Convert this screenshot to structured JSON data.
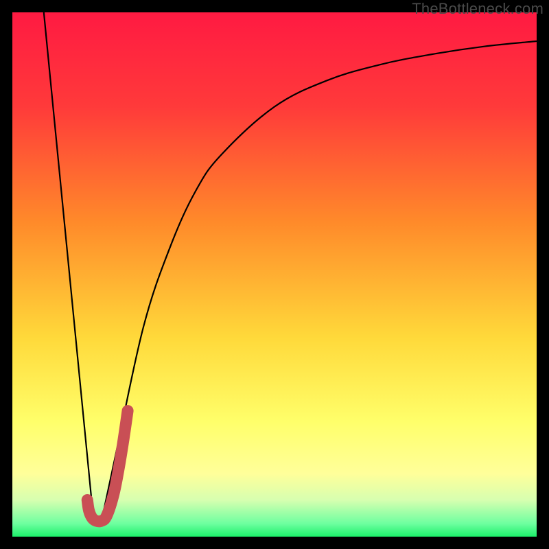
{
  "attribution": "TheBottleneck.com",
  "colors": {
    "bg_black": "#000000",
    "grad_top_red": "#ff1a42",
    "grad_orange": "#ff8a2a",
    "grad_yellow": "#ffe83a",
    "grad_pale_yellow": "#ffff9a",
    "grad_pale_green": "#c7ffa0",
    "grad_green": "#1cf06a",
    "curve_black": "#000000",
    "j_red": "#c94f55"
  },
  "chart_data": {
    "type": "line",
    "title": "",
    "xlabel": "",
    "ylabel": "",
    "xlim": [
      0,
      100
    ],
    "ylim": [
      0,
      100
    ],
    "grid": false,
    "legend": false,
    "series": [
      {
        "name": "left-line",
        "description": "Straight descending line from top-left toward bottom-left minimum",
        "x": [
          6,
          15.5
        ],
        "values": [
          100,
          3
        ]
      },
      {
        "name": "right-curve",
        "description": "Logarithmic-style ascending curve from minimum toward upper-right",
        "x": [
          17,
          20,
          25,
          30,
          35,
          40,
          50,
          60,
          70,
          80,
          90,
          100
        ],
        "values": [
          3,
          17,
          40,
          55,
          66,
          73,
          82,
          87,
          90,
          92,
          93.5,
          94.5
        ]
      },
      {
        "name": "j-mark",
        "description": "Thick red J-shaped mark at the curve minimum",
        "x": [
          14.3,
          14.6,
          15.2,
          16.0,
          17.0,
          18.0,
          19.3,
          20.3,
          21.2,
          22.0
        ],
        "values": [
          7.0,
          5.0,
          3.6,
          3.0,
          3.0,
          4.0,
          8.0,
          13.0,
          18.5,
          24.0
        ]
      }
    ],
    "gradient_stops": [
      {
        "pos": 0.0,
        "color": "#ff1a42"
      },
      {
        "pos": 0.18,
        "color": "#ff3a3a"
      },
      {
        "pos": 0.4,
        "color": "#ff8a2a"
      },
      {
        "pos": 0.62,
        "color": "#ffd93a"
      },
      {
        "pos": 0.78,
        "color": "#ffff6a"
      },
      {
        "pos": 0.88,
        "color": "#ffff9a"
      },
      {
        "pos": 0.93,
        "color": "#d7ffb0"
      },
      {
        "pos": 0.975,
        "color": "#6effa0"
      },
      {
        "pos": 1.0,
        "color": "#1cf06a"
      }
    ]
  }
}
